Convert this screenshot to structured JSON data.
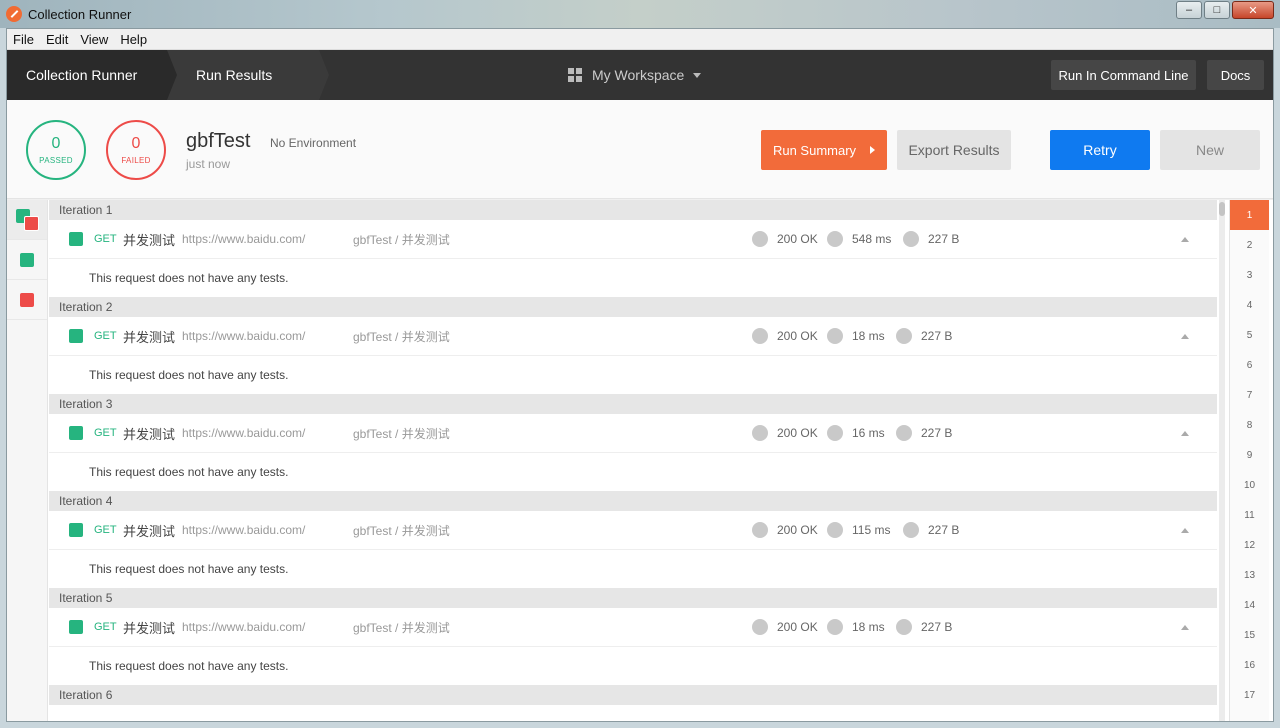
{
  "window": {
    "title": "Collection Runner",
    "min": "–",
    "max": "□",
    "close": "✕"
  },
  "menu": [
    "File",
    "Edit",
    "View",
    "Help"
  ],
  "header": {
    "crumb1": "Collection Runner",
    "crumb2": "Run Results",
    "workspace": "My Workspace",
    "cli_btn": "Run In Command Line",
    "docs_btn": "Docs"
  },
  "summary": {
    "passed_count": "0",
    "passed_label": "PASSED",
    "failed_count": "0",
    "failed_label": "FAILED",
    "collection": "gbfTest",
    "environment": "No Environment",
    "time": "just now",
    "run_summary_btn": "Run Summary",
    "export_btn": "Export Results",
    "retry_btn": "Retry",
    "new_btn": "New"
  },
  "colors": {
    "pass": "#26b47f",
    "fail": "#ed4b48",
    "accent": "#f26b3a",
    "primary": "#0f7af0"
  },
  "iterations": [
    {
      "label": "Iteration 1",
      "method": "GET",
      "name": "并发测试",
      "url": "https://www.baidu.com/",
      "path": "gbfTest / 并发测试",
      "status": "200 OK",
      "time": "548 ms",
      "size": "227 B",
      "tests": "This request does not have any tests."
    },
    {
      "label": "Iteration 2",
      "method": "GET",
      "name": "并发测试",
      "url": "https://www.baidu.com/",
      "path": "gbfTest / 并发测试",
      "status": "200 OK",
      "time": "18 ms",
      "size": "227 B",
      "tests": "This request does not have any tests."
    },
    {
      "label": "Iteration 3",
      "method": "GET",
      "name": "并发测试",
      "url": "https://www.baidu.com/",
      "path": "gbfTest / 并发测试",
      "status": "200 OK",
      "time": "16 ms",
      "size": "227 B",
      "tests": "This request does not have any tests."
    },
    {
      "label": "Iteration 4",
      "method": "GET",
      "name": "并发测试",
      "url": "https://www.baidu.com/",
      "path": "gbfTest / 并发测试",
      "status": "200 OK",
      "time": "115 ms",
      "size": "227 B",
      "tests": "This request does not have any tests."
    },
    {
      "label": "Iteration 5",
      "method": "GET",
      "name": "并发测试",
      "url": "https://www.baidu.com/",
      "path": "gbfTest / 并发测试",
      "status": "200 OK",
      "time": "18 ms",
      "size": "227 B",
      "tests": "This request does not have any tests."
    },
    {
      "label": "Iteration 6"
    }
  ],
  "iteration_nav": [
    "1",
    "2",
    "3",
    "4",
    "5",
    "6",
    "7",
    "8",
    "9",
    "10",
    "11",
    "12",
    "13",
    "14",
    "15",
    "16",
    "17"
  ]
}
